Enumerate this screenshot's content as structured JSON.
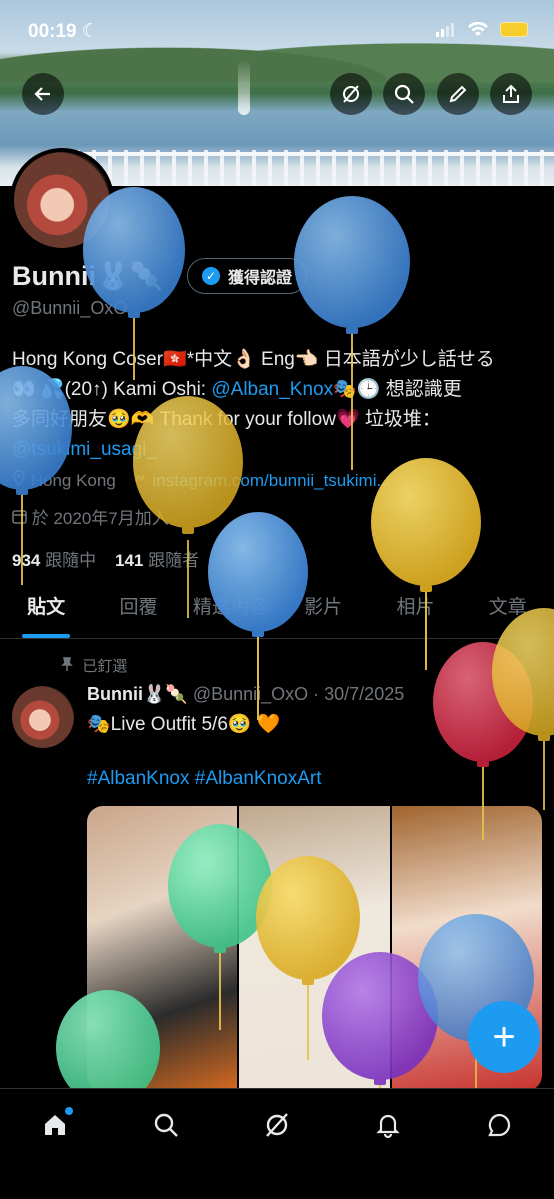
{
  "status": {
    "time": "00:19",
    "moon": "☾"
  },
  "profile": {
    "name": "Bunnii🐰🍡",
    "verify_label": "獲得認證",
    "handle": "@Bunnii_OxO",
    "bio_1": "Hong Kong Coser🇭🇰*中文👌🏻 Eng👈🏻 日本語が少し話せる",
    "bio_2": "👀 💦(20↑) Kami Oshi: ",
    "bio_mention": "@Alban_Knox",
    "bio_3": "🎭🕒 想認識更",
    "bio_4": "多同好朋友🥹🫶 Thank for your follow💗 垃圾堆：",
    "bio_link": "@tsukimi_usagi_",
    "location": "Hong Kong",
    "website": "instagram.com/bunnii_tsukimi...",
    "joined": "於 2020年7月加入",
    "following_count": "934",
    "following_label": "跟隨中",
    "followers_count": "141",
    "followers_label": "跟隨者"
  },
  "tabs": [
    "貼文",
    "回覆",
    "精選內容",
    "影片",
    "相片",
    "文章"
  ],
  "post": {
    "pinned_label": "已釘選",
    "author": "Bunnii🐰🍡",
    "handle_date": "@Bunnii_OxO · 30/7/2025",
    "text": "🎭Live Outfit 5/6🥹 🧡",
    "hashtags": "#AlbanKnox #AlbanKnoxArt"
  },
  "fab_label": "+",
  "nav_icons": [
    "home-icon",
    "search-icon",
    "grok-icon",
    "bell-icon",
    "messages-icon"
  ],
  "colors": {
    "accent": "#1d9bf0",
    "background": "#000000",
    "muted": "#71767b"
  }
}
